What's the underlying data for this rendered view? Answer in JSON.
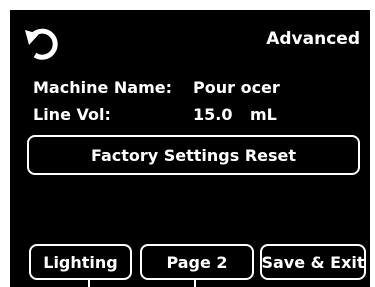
{
  "header": {
    "back_icon": "rotate-left-icon",
    "advanced_label": "Advanced"
  },
  "info": {
    "machine_name_label": "Machine Name:",
    "machine_name_value": "Pour ocer",
    "line_vol_label": "Line Vol:",
    "line_vol_value": "15.0",
    "line_vol_unit": "mL"
  },
  "actions": {
    "factory_reset_label": "Factory Settings Reset"
  },
  "footer": {
    "lighting_label": "Lighting",
    "page2_label": "Page 2",
    "save_exit_label": "Save & Exit"
  },
  "colors": {
    "background": "#000000",
    "foreground": "#ffffff"
  }
}
